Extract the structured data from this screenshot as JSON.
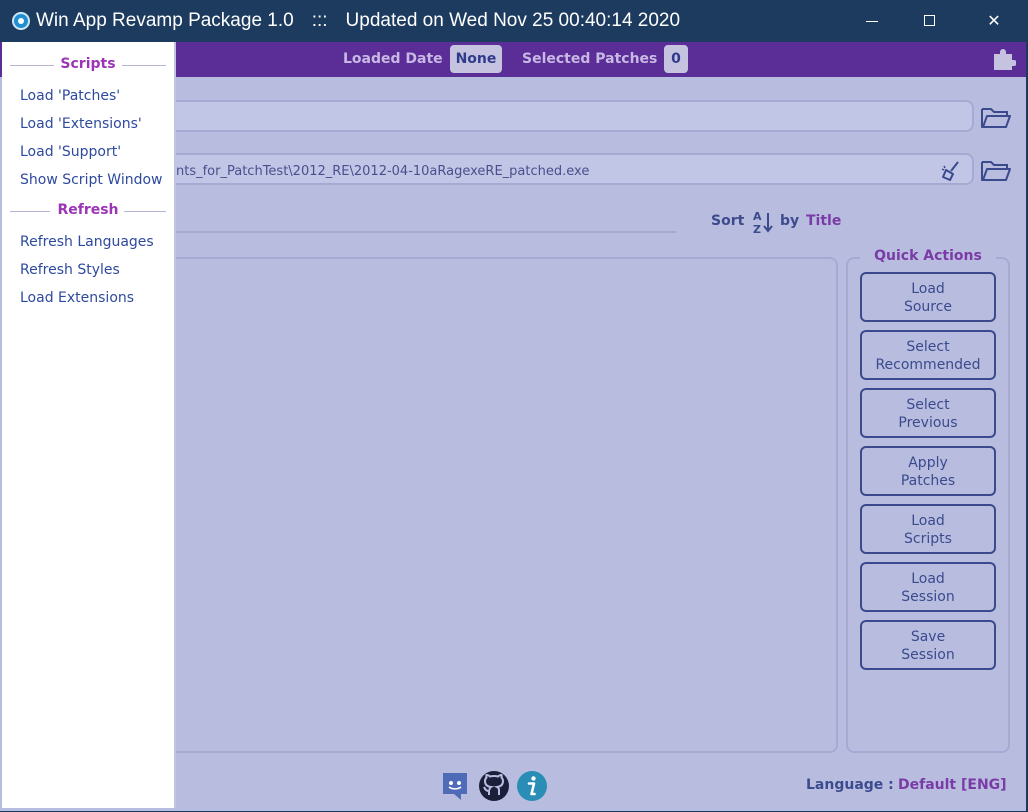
{
  "window": {
    "title": "Win App Revamp Package 1.0",
    "separator": ":::",
    "updated": "Updated on Wed Nov 25 00:40:14 2020",
    "controls": {
      "minimize": "minimize",
      "maximize": "maximize",
      "close": "✕"
    }
  },
  "header": {
    "loaded_date_label": "Loaded Date",
    "loaded_date_value": "None",
    "selected_patches_label": "Selected Patches",
    "selected_patches_value": "0"
  },
  "source": {
    "output_path": "nts_for_PatchTest\\2012_RE\\2012-04-10aRagexeRE_patched.exe"
  },
  "sort": {
    "label": "Sort",
    "by": "by",
    "value": "Title"
  },
  "quick_actions": {
    "title": "Quick Actions",
    "buttons": [
      {
        "line1": "Load",
        "line2": "Source"
      },
      {
        "line1": "Select",
        "line2": "Recommended"
      },
      {
        "line1": "Select",
        "line2": "Previous"
      },
      {
        "line1": "Apply",
        "line2": "Patches"
      },
      {
        "line1": "Load",
        "line2": "Scripts"
      },
      {
        "line1": "Load",
        "line2": "Session"
      },
      {
        "line1": "Save",
        "line2": "Session"
      }
    ]
  },
  "footer": {
    "language_label": "Language :",
    "language_value": "Default [ENG]"
  },
  "drawer": {
    "scripts_title": "Scripts",
    "scripts_items": [
      "Load 'Patches'",
      "Load 'Extensions'",
      "Load 'Support'",
      "Show Script Window"
    ],
    "refresh_title": "Refresh",
    "refresh_items": [
      "Refresh Languages",
      "Refresh Styles",
      "Load Extensions"
    ]
  },
  "icons": [
    "app-icon",
    "puzzle-icon",
    "folder-open-icon",
    "broom-icon",
    "sort-az-icon",
    "discord-icon",
    "github-icon",
    "info-icon"
  ],
  "colors": {
    "accent_purple": "#5b2d97",
    "title_blue": "#1c3b5e",
    "background": "#b8bde0",
    "link_blue": "#2e4a9e",
    "section_purple": "#9b35b5"
  }
}
